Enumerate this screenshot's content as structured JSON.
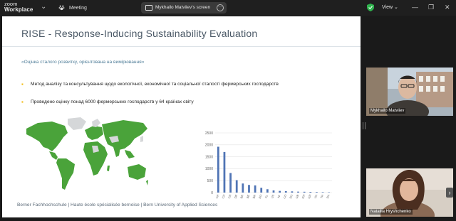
{
  "app": {
    "brand_line1": "zoom",
    "brand_line2": "Workplace",
    "meeting_label": "Meeting"
  },
  "share": {
    "label": "Mykhailo Matviiev's screen"
  },
  "topbar": {
    "view_label": "View"
  },
  "slide": {
    "title": "RISE - Response-Inducing Sustainability Evaluation",
    "subtitle": "«Оцінка сталого розвитку, орієнтована на вимірювання»",
    "bullets": [
      "Метод аналізу та консультування щодо екологічної, економічної та соціальної сталості фермерських господарств",
      "Проведено оцінку  понад 6000 фермерських господарств у 64 країнах світу"
    ],
    "footer": "Berner Fachhochschule | Haute école spécialisée bernoise | Bern University of Applied Sciences"
  },
  "chart_data": {
    "type": "bar",
    "title": "",
    "xlabel": "",
    "ylabel": "",
    "ylim": [
      0,
      2500
    ],
    "yticks": [
      "0",
      "500",
      "1000",
      "1500",
      "2000",
      "2500"
    ],
    "categories": [
      "CH",
      "CH",
      "CN",
      "DE",
      "BR",
      "BE",
      "BR",
      "RO",
      "FL",
      "US",
      "NI",
      "CO",
      "RU",
      "GB",
      "GH",
      "GR",
      "UA",
      "TH",
      "RA"
    ],
    "values": [
      1920,
      1700,
      820,
      520,
      380,
      320,
      300,
      200,
      140,
      90,
      70,
      60,
      50,
      40,
      35,
      30,
      25,
      20,
      15
    ],
    "bar_color": "#4f74b5",
    "grid": true
  },
  "map": {
    "highlight_color": "#4aa33a",
    "base_color": "#d5d7d9"
  },
  "participants": [
    {
      "name": "Mykhailo Matviiev"
    },
    {
      "name": "Nataliia Hryshchenko"
    }
  ],
  "colors": {
    "accent_bullet": "#f2b600",
    "title": "#4a5866"
  }
}
